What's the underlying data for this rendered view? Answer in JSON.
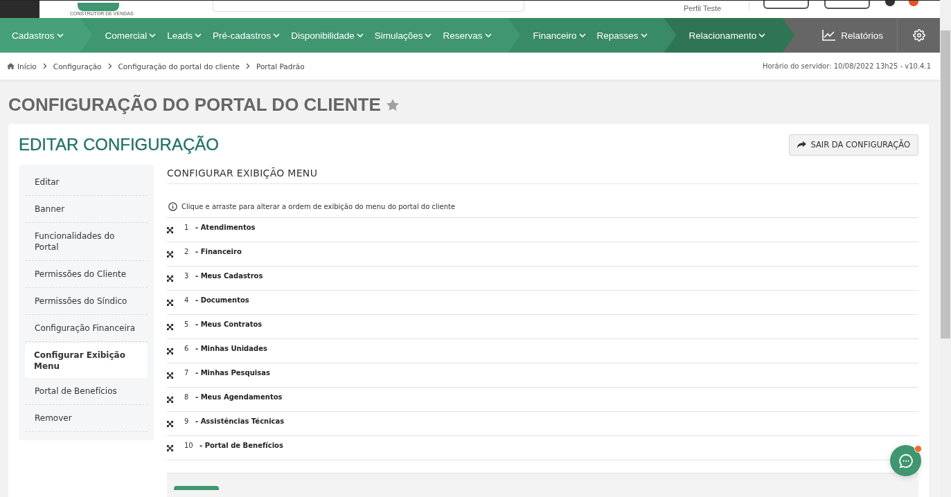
{
  "header": {
    "logo_subtitle": "CONSTRUTOR DE VENDAS",
    "profile": "Perfil Teste"
  },
  "nav": {
    "groups": [
      {
        "color": "#46a07a",
        "items": [
          {
            "label": "Cadastros"
          }
        ]
      },
      {
        "color": "#3f9671",
        "items": [
          {
            "label": "Comercial"
          },
          {
            "label": "Leads"
          },
          {
            "label": "Pré-cadastros"
          },
          {
            "label": "Disponibilidade"
          },
          {
            "label": "Simulações"
          },
          {
            "label": "Reservas"
          }
        ]
      },
      {
        "color": "#398a66",
        "items": [
          {
            "label": "Financeiro"
          },
          {
            "label": "Repasses"
          }
        ]
      },
      {
        "color": "#2f7455",
        "items": [
          {
            "label": "Relacionamento"
          }
        ]
      }
    ],
    "reports": "Relatórios"
  },
  "breadcrumb": {
    "items": [
      "Início",
      "Configuração",
      "Configuração do portal do cliente",
      "Portal Padrão"
    ],
    "server_time": "Horário do servidor: 10/08/2022 13h25 - v10.4.1"
  },
  "page_title": "CONFIGURAÇÃO DO PORTAL DO CLIENTE",
  "favorite": false,
  "card": {
    "title": "EDITAR CONFIGURAÇÃO",
    "exit_button": "SAIR DA CONFIGURAÇÃO"
  },
  "sidebar": {
    "items": [
      {
        "label": "Editar",
        "selected": false
      },
      {
        "label": "Banner",
        "selected": false
      },
      {
        "label": "Funcionalidades do Portal",
        "selected": false
      },
      {
        "label": "Permissões do Cliente",
        "selected": false
      },
      {
        "label": "Permissões do Síndico",
        "selected": false
      },
      {
        "label": "Configuração Financeira",
        "selected": false
      },
      {
        "label": "Configurar Exibição Menu",
        "selected": true
      },
      {
        "label": "Portal de Benefícios",
        "selected": false
      },
      {
        "label": "Remover",
        "selected": false
      }
    ]
  },
  "section": {
    "title": "CONFIGURAR EXIBIÇÃO MENU",
    "hint": "Clique e arraste para alterar a ordem de exibição do menu do portal do cliente",
    "items": [
      {
        "number": "1",
        "label": "- Atendimentos"
      },
      {
        "number": "2",
        "label": "- Financeiro"
      },
      {
        "number": "3",
        "label": "- Meus Cadastros"
      },
      {
        "number": "4",
        "label": "- Documentos"
      },
      {
        "number": "5",
        "label": "- Meus Contratos"
      },
      {
        "number": "6",
        "label": "- Minhas Unidades"
      },
      {
        "number": "7",
        "label": "- Minhas Pesquisas"
      },
      {
        "number": "8",
        "label": "- Meus Agendamentos"
      },
      {
        "number": "9",
        "label": "- Assistências Técnicas"
      },
      {
        "number": "10",
        "label": "- Portal de Benefícios"
      }
    ]
  },
  "chat": {
    "unread": true
  }
}
